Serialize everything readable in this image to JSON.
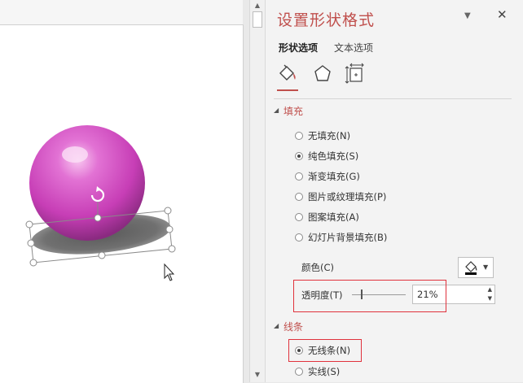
{
  "pane": {
    "title": "设置形状格式",
    "dropdown_icon": "▼",
    "close_icon": "✕",
    "tabs": [
      "形状选项",
      "文本选项"
    ],
    "category_icons": [
      "fill-line-icon",
      "effects-icon",
      "size-properties-icon"
    ]
  },
  "fill_section": {
    "title": "填充",
    "options": [
      {
        "label": "无填充(N)",
        "checked": false
      },
      {
        "label": "纯色填充(S)",
        "checked": true
      },
      {
        "label": "渐变填充(G)",
        "checked": false
      },
      {
        "label": "图片或纹理填充(P)",
        "checked": false
      },
      {
        "label": "图案填充(A)",
        "checked": false
      },
      {
        "label": "幻灯片背景填充(B)",
        "checked": false
      }
    ],
    "color_label": "颜色(C)",
    "transparency_label": "透明度(T)",
    "transparency_value": "21%",
    "transparency_fraction": 0.21
  },
  "line_section": {
    "title": "线条",
    "options": [
      {
        "label": "无线条(N)",
        "checked": true
      },
      {
        "label": "实线(S)",
        "checked": false
      }
    ]
  },
  "colors": {
    "accent": "#c0504d",
    "highlight": "#e0323c",
    "sphere": "#cc44b8",
    "shadow": "#606060"
  }
}
